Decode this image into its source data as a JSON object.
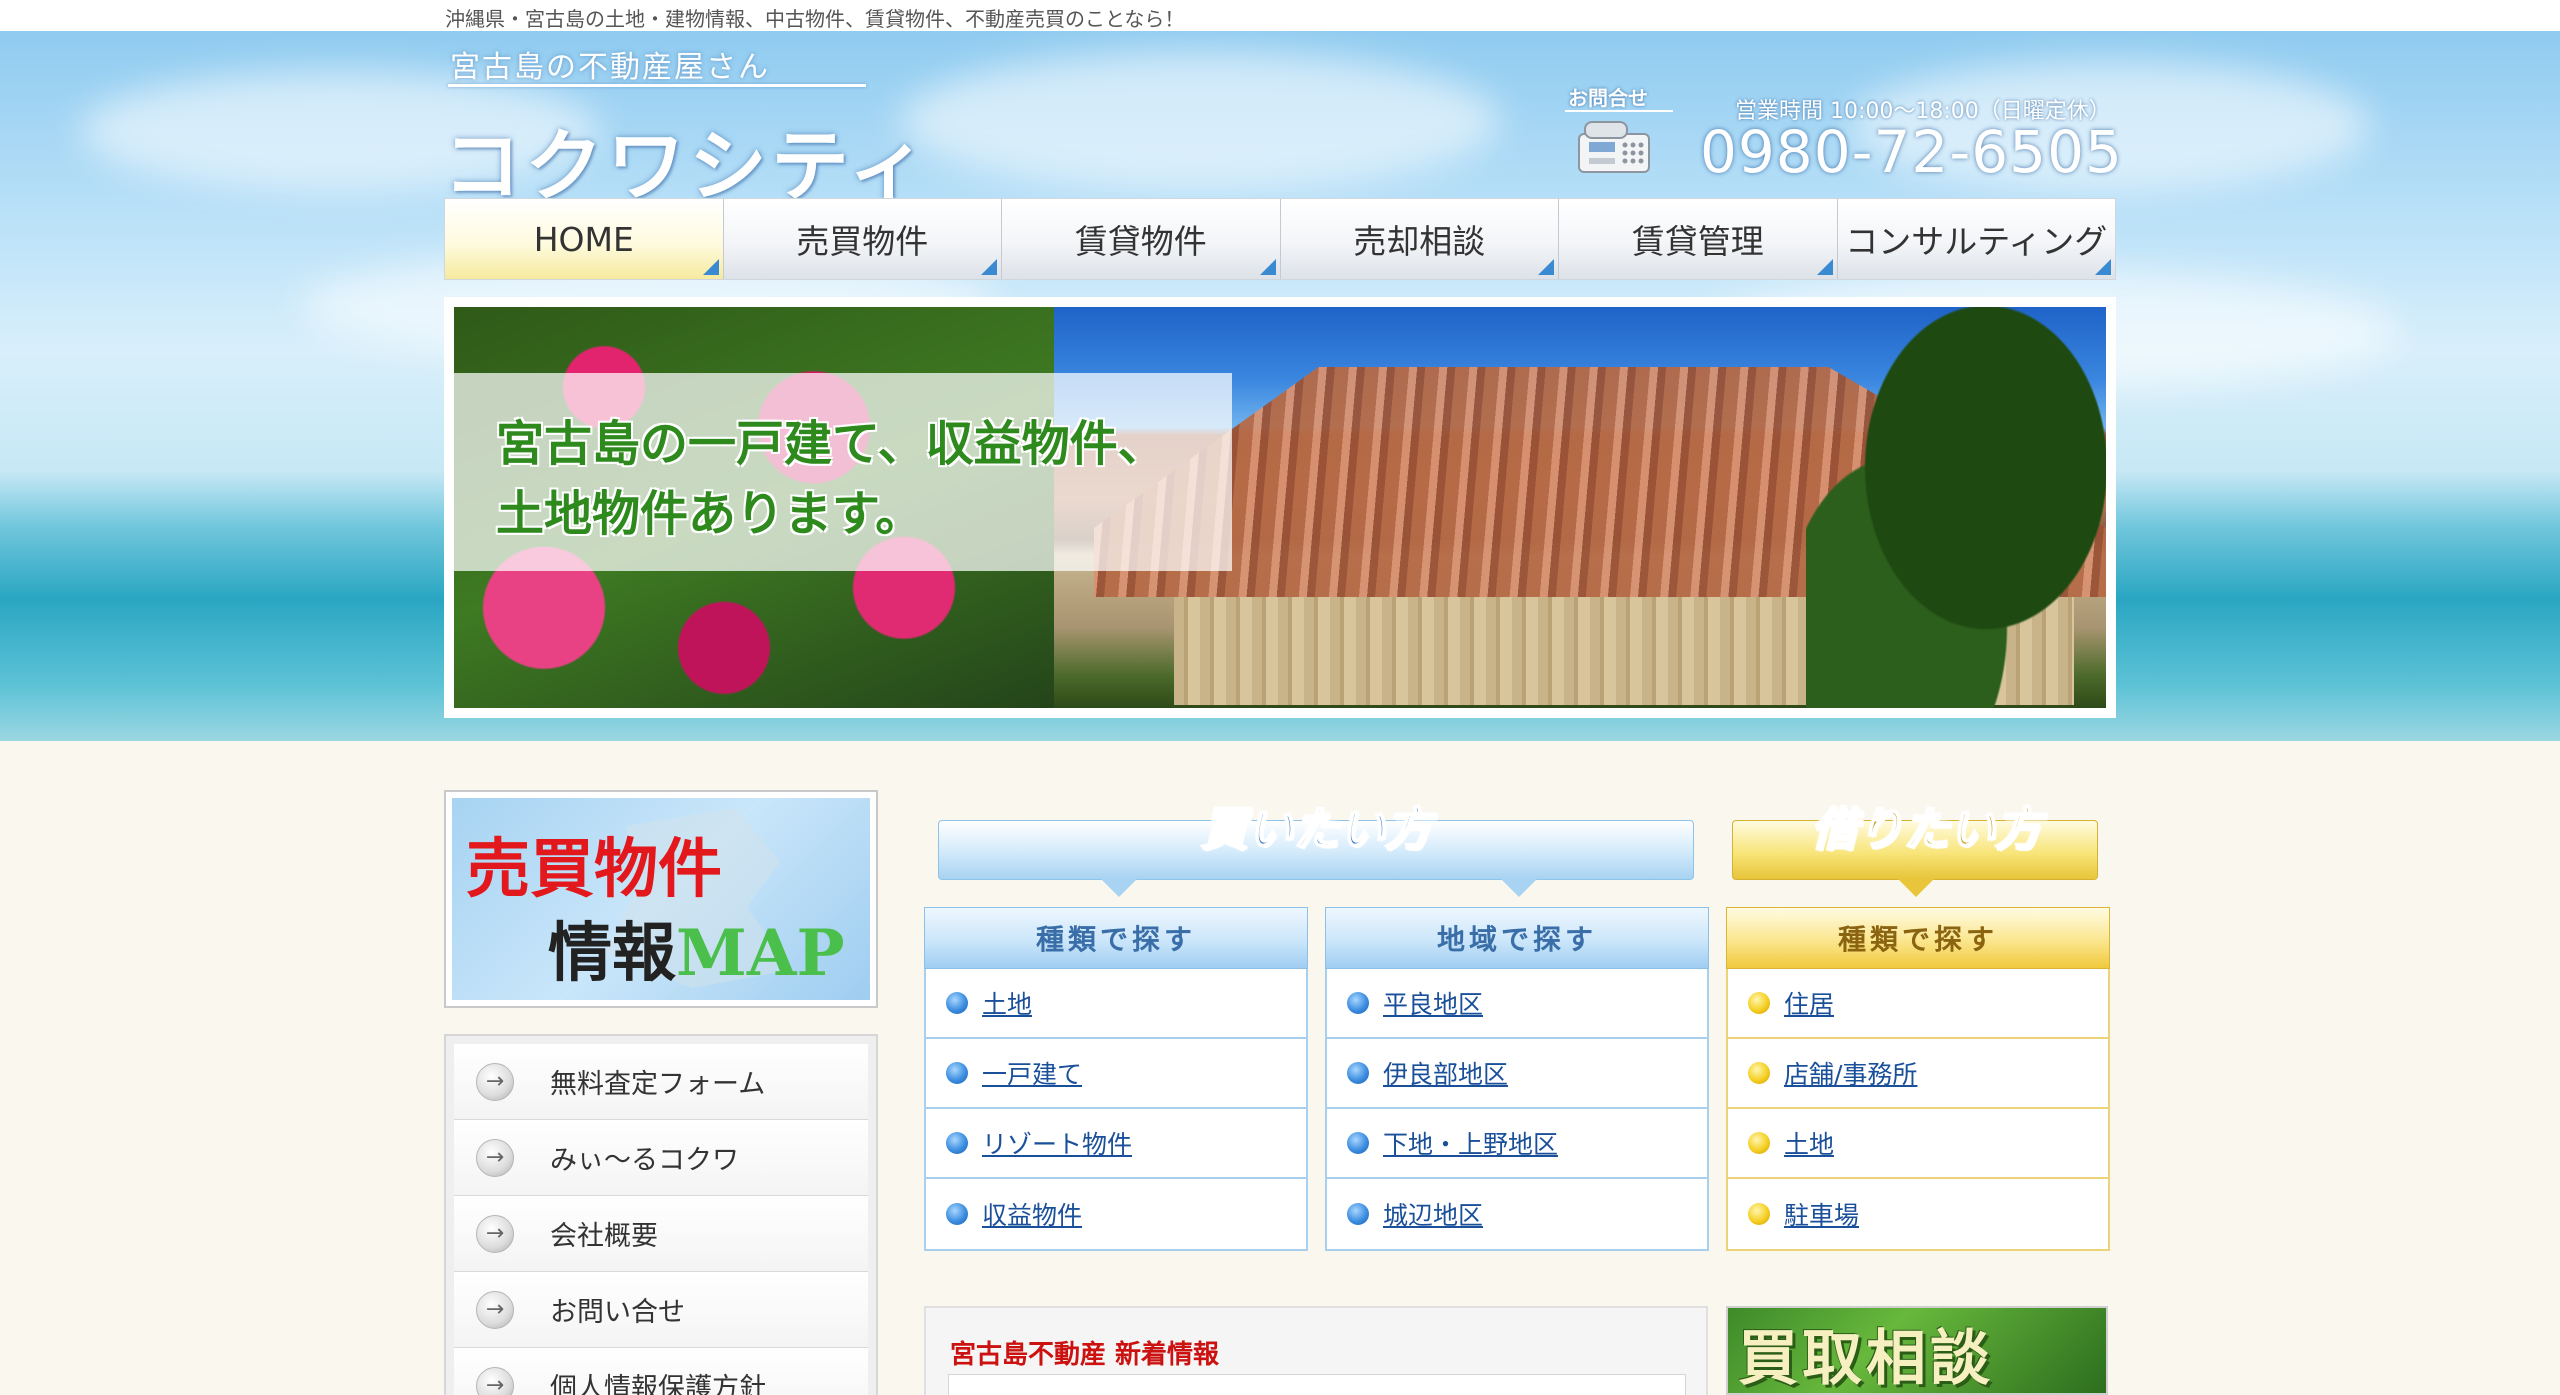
{
  "header": {
    "tagline": "沖縄県・宮古島の土地・建物情報、中古物件、賃貸物件、不動産売買のことなら！",
    "logo_sub": "宮古島の不動産屋さん",
    "logo_main": "コクワシティ",
    "contact_label": "お問合せ",
    "hours": "営業時間 10:00～18:00（日曜定休）",
    "phone": "0980-72-6505"
  },
  "nav": {
    "items": [
      {
        "label": "HOME"
      },
      {
        "label": "売買物件"
      },
      {
        "label": "賃貸物件"
      },
      {
        "label": "売却相談"
      },
      {
        "label": "賃貸管理"
      },
      {
        "label": "コンサルティング"
      }
    ]
  },
  "banner": {
    "line1": "宮古島の一戸建て、収益物件、",
    "line2": "土地物件あります。"
  },
  "sidebar": {
    "map_title_line1": "売買物件",
    "map_title_line2": "情報",
    "map_title_accent": "MAP",
    "menu": [
      {
        "label": "無料査定フォーム"
      },
      {
        "label": "みぃ～るコクワ"
      },
      {
        "label": "会社概要"
      },
      {
        "label": "お問い合せ"
      },
      {
        "label": "個人情報保護方針"
      }
    ]
  },
  "buy": {
    "ribbon_title": "買いたい方",
    "by_type": {
      "heading": "種類で探す",
      "items": [
        "土地",
        "一戸建て",
        "リゾート物件",
        "収益物件"
      ]
    },
    "by_area": {
      "heading": "地域で探す",
      "items": [
        "平良地区",
        "伊良部地区",
        "下地・上野地区",
        "城辺地区"
      ]
    }
  },
  "rent": {
    "ribbon_title": "借りたい方",
    "by_type": {
      "heading": "種類で探す",
      "items": [
        "住居",
        "店舗/事務所",
        "土地",
        "駐車場"
      ]
    }
  },
  "news": {
    "title": "宮古島不動産 新着情報"
  },
  "kaitori": {
    "label": "買取相談"
  },
  "colors": {
    "accent_blue": "#3a8ad2",
    "accent_yellow": "#f0c93c",
    "news_red": "#cc1111",
    "banner_green": "#2f8a1e"
  }
}
